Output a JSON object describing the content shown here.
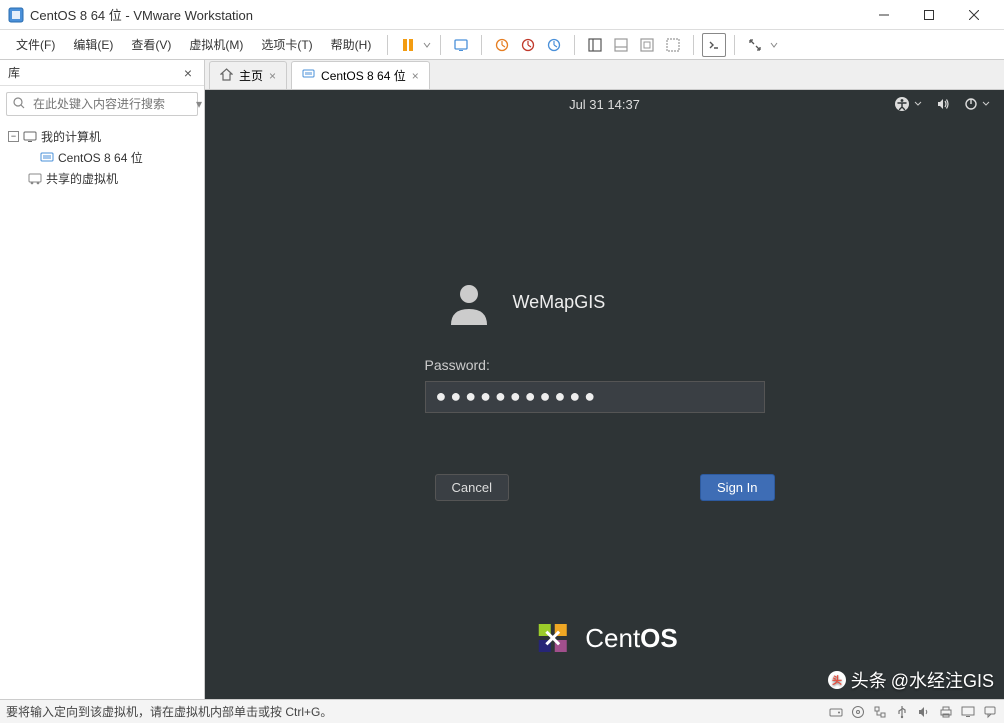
{
  "window": {
    "title": "CentOS 8 64 位 - VMware Workstation"
  },
  "menu": {
    "file": "文件(F)",
    "edit": "编辑(E)",
    "view": "查看(V)",
    "vm": "虚拟机(M)",
    "tabs": "选项卡(T)",
    "help": "帮助(H)"
  },
  "sidebar": {
    "title": "库",
    "search_placeholder": "在此处键入内容进行搜索",
    "root": "我的计算机",
    "vm_item": "CentOS 8 64 位",
    "shared": "共享的虚拟机"
  },
  "tabs": {
    "home": "主页",
    "active": "CentOS 8 64 位"
  },
  "gnome": {
    "clock": "Jul 31  14:37",
    "username": "WeMapGIS",
    "password_label": "Password:",
    "password_value": "●●●●●●●●●●●",
    "cancel": "Cancel",
    "signin": "Sign In",
    "distro_prefix": "Cent",
    "distro_suffix": "OS"
  },
  "watermark": {
    "prefix": "头条",
    "handle": "@水经注GIS"
  },
  "statusbar": {
    "text": "要将输入定向到该虚拟机，请在虚拟机内部单击或按 Ctrl+G。"
  }
}
